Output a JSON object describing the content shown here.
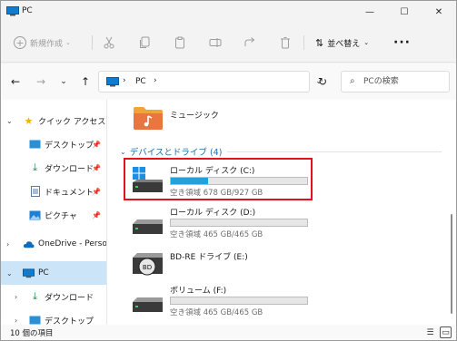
{
  "window": {
    "title": "PC"
  },
  "toolbar": {
    "new_label": "新規作成",
    "sort_label": "並べ替え"
  },
  "address": {
    "location": "PC"
  },
  "search": {
    "placeholder": "PCの検索"
  },
  "sidebar": {
    "items": [
      {
        "label": "クイック アクセス"
      },
      {
        "label": "デスクトップ"
      },
      {
        "label": "ダウンロード"
      },
      {
        "label": "ドキュメント"
      },
      {
        "label": "ピクチャ"
      },
      {
        "label": "OneDrive - Perso"
      },
      {
        "label": "PC"
      },
      {
        "label": "ダウンロード"
      },
      {
        "label": "デスクトップ"
      }
    ]
  },
  "content": {
    "music_folder": "ミュージック",
    "section_title": "デバイスとドライブ (4)",
    "drives": [
      {
        "name": "ローカル ディスク (C:)",
        "free_text": "空き領域 678 GB/927 GB",
        "used_fraction": 0.27
      },
      {
        "name": "ローカル ディスク (D:)",
        "free_text": "空き領域 465 GB/465 GB",
        "used_fraction": 0.0
      },
      {
        "name": "BD-RE ドライブ (E:)",
        "free_text": "",
        "used_fraction": null
      },
      {
        "name": "ボリューム (F:)",
        "free_text": "空き領域 465 GB/465 GB",
        "used_fraction": 0.0
      }
    ]
  },
  "status": {
    "text": "10 個の項目"
  },
  "colors": {
    "accent": "#26a0da",
    "selected_bg": "#cce4f7",
    "highlight": "#e0121c",
    "section": "#1e6fa8"
  }
}
